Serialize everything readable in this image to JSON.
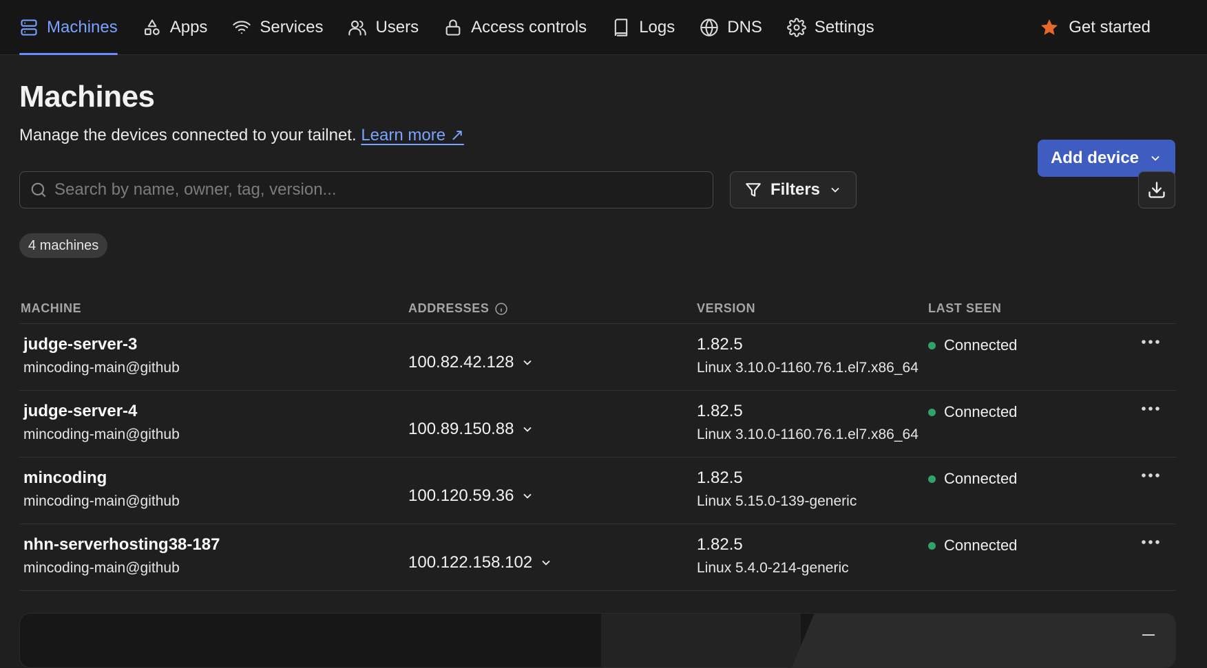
{
  "nav": {
    "items": [
      {
        "label": "Machines",
        "icon": "server-icon",
        "active": true
      },
      {
        "label": "Apps",
        "icon": "apps-icon",
        "active": false
      },
      {
        "label": "Services",
        "icon": "wifi-icon",
        "active": false
      },
      {
        "label": "Users",
        "icon": "users-icon",
        "active": false
      },
      {
        "label": "Access controls",
        "icon": "lock-icon",
        "active": false
      },
      {
        "label": "Logs",
        "icon": "book-icon",
        "active": false
      },
      {
        "label": "DNS",
        "icon": "globe-icon",
        "active": false
      },
      {
        "label": "Settings",
        "icon": "gear-icon",
        "active": false
      }
    ],
    "get_started": "Get started"
  },
  "header": {
    "title": "Machines",
    "subtitle": "Manage the devices connected to your tailnet.",
    "learn_more": "Learn more ↗",
    "add_device": "Add device"
  },
  "toolbar": {
    "search_placeholder": "Search by name, owner, tag, version...",
    "filters": "Filters"
  },
  "count": "4 machines",
  "table": {
    "columns": [
      "MACHINE",
      "ADDRESSES",
      "VERSION",
      "LAST SEEN"
    ],
    "rows": [
      {
        "name": "judge-server-3",
        "owner": "mincoding-main@github",
        "address": "100.82.42.128",
        "version": "1.82.5",
        "os": "Linux 3.10.0-1160.76.1.el7.x86_64",
        "status": "Connected"
      },
      {
        "name": "judge-server-4",
        "owner": "mincoding-main@github",
        "address": "100.89.150.88",
        "version": "1.82.5",
        "os": "Linux 3.10.0-1160.76.1.el7.x86_64",
        "status": "Connected"
      },
      {
        "name": "mincoding",
        "owner": "mincoding-main@github",
        "address": "100.120.59.36",
        "version": "1.82.5",
        "os": "Linux 5.15.0-139-generic",
        "status": "Connected"
      },
      {
        "name": "nhn-serverhosting38-187",
        "owner": "mincoding-main@github",
        "address": "100.122.158.102",
        "version": "1.82.5",
        "os": "Linux 5.4.0-214-generic",
        "status": "Connected"
      }
    ]
  },
  "colors": {
    "accent": "#7aa2ff",
    "primary_button": "#3f5cc0",
    "status_connected": "#2fa36b",
    "get_started_star": "#e4692a"
  }
}
